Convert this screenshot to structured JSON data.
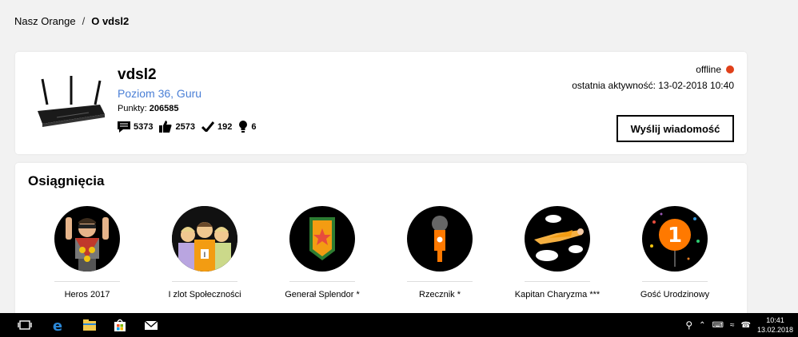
{
  "breadcrumb": {
    "home": "Nasz Orange",
    "separator": "/",
    "current": "O vdsl2"
  },
  "profile": {
    "name": "vdsl2",
    "level": "Poziom 36, Guru",
    "points_label": "Punkty:",
    "points_value": "206585",
    "stats": {
      "messages": "5373",
      "likes": "2573",
      "solutions": "192",
      "ideas": "6"
    },
    "status": "offline",
    "status_color": "#e0401a",
    "last_activity": "ostatnia aktywność: 13-02-2018 10:40",
    "send_message_label": "Wyślij wiadomość"
  },
  "achievements": {
    "title": "Osiągnięcia",
    "items": [
      {
        "label": "Heros 2017",
        "icon": "hero-icon"
      },
      {
        "label": "I zlot Społeczności",
        "icon": "community-meetup-icon"
      },
      {
        "label": "Generał Splendor *",
        "icon": "general-shield-icon"
      },
      {
        "label": "Rzecznik *",
        "icon": "microphone-icon"
      },
      {
        "label": "Kapitan Charyzma ***",
        "icon": "flying-captain-icon"
      },
      {
        "label": "Gość Urodzinowy",
        "icon": "birthday-balloon-icon"
      }
    ]
  },
  "taskbar": {
    "time": "10:41",
    "date": "13.02.2018"
  }
}
